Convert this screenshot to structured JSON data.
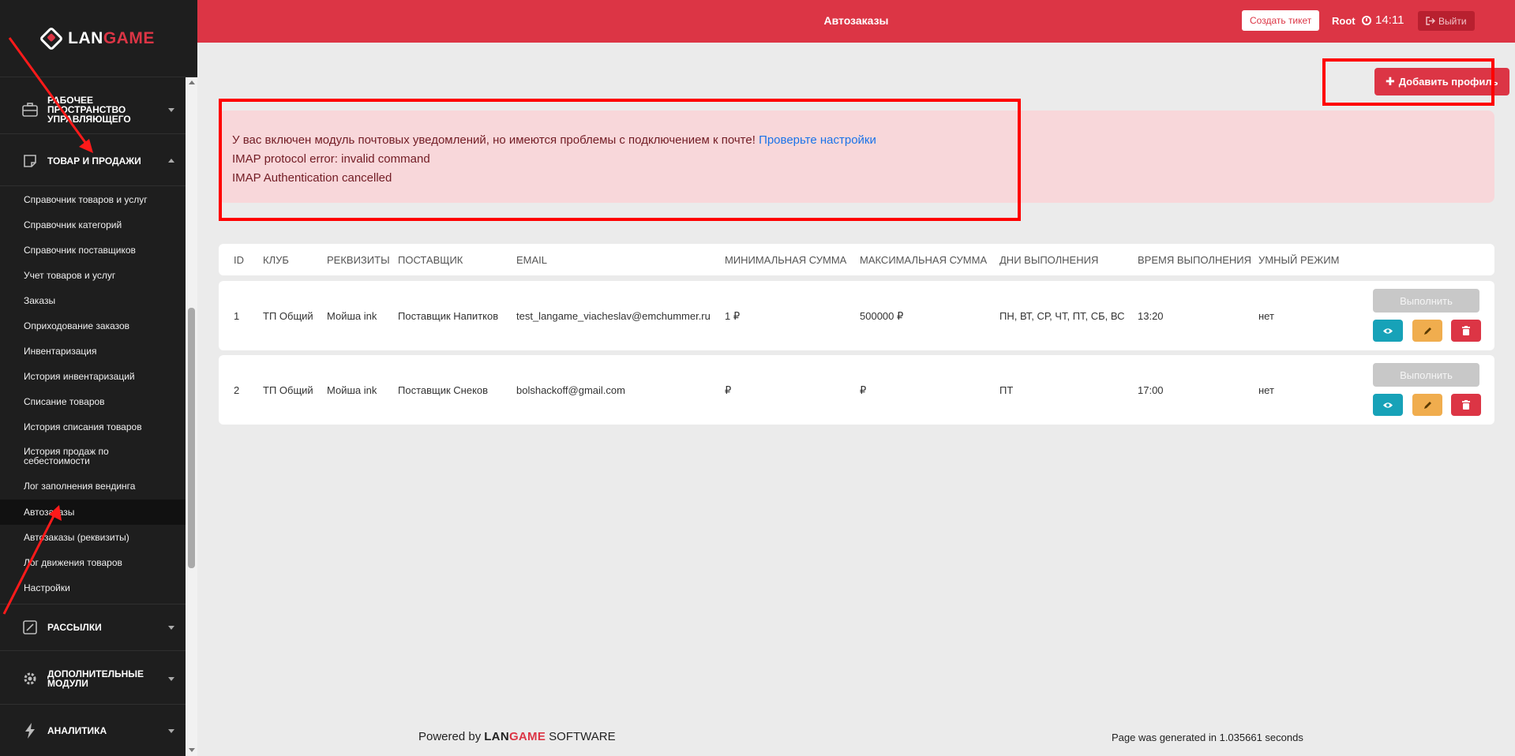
{
  "app": {
    "logo": {
      "text_main": "LAN",
      "text_accent": "GAME"
    }
  },
  "header": {
    "title": "Автозаказы",
    "ticket_button": "Создать тикет",
    "user": "Root",
    "time": "14:11",
    "logout": "Выйти"
  },
  "sidebar": {
    "sections": [
      {
        "label": "Рабочее пространство управляющего",
        "icon": "briefcase-icon",
        "expanded": false
      },
      {
        "label": "Товар и продажи",
        "icon": "sticky-note-icon",
        "expanded": true
      },
      {
        "label": "Рассылки",
        "icon": "edit-icon",
        "expanded": false
      },
      {
        "label": "Дополнительные модули",
        "icon": "gear-icon",
        "expanded": false
      },
      {
        "label": "Аналитика",
        "icon": "lightning-icon",
        "expanded": false
      }
    ],
    "items": [
      "Справочник товаров и услуг",
      "Справочник категорий",
      "Справочник поставщиков",
      "Учет товаров и услуг",
      "Заказы",
      "Оприходование заказов",
      "Инвентаризация",
      "История инвентаризаций",
      "Списание товаров",
      "История списания товаров",
      "История продаж по себестоимости",
      "Лог заполнения вендинга",
      "Автозаказы",
      "Автозаказы (реквизиты)",
      "Лог движения товаров",
      "Настройки"
    ],
    "active_item": "Автозаказы"
  },
  "main": {
    "add_profile_button": "Добавить профиль",
    "alert": {
      "text": "У вас включен модуль почтовых уведомлений, но имеются проблемы с подключением к почте! ",
      "link": "Проверьте настройки",
      "line2": "IMAP protocol error: invalid command",
      "line3": "IMAP Authentication cancelled"
    },
    "table": {
      "headers": [
        "ID",
        "Клуб",
        "Реквизиты",
        "Поставщик",
        "Email",
        "Минимальная сумма",
        "Максимальная сумма",
        "Дни выполнения",
        "Время выполнения",
        "Умный режим"
      ],
      "rows": [
        [
          "1",
          "ТП Общий",
          "Мойша ink",
          "Поставщик Напитков",
          "test_langame_viacheslav@emchummer.ru",
          "1 ₽",
          "500000 ₽",
          "ПН, ВТ, СР, ЧТ, ПТ, СБ, ВС",
          "13:20",
          "нет"
        ],
        [
          "2",
          "ТП Общий",
          "Мойша ink",
          "Поставщик Снеков",
          "bolshackoff@gmail.com",
          "₽",
          "₽",
          "ПТ",
          "17:00",
          "нет"
        ]
      ],
      "execute_label": "Выполнить"
    }
  },
  "footer": {
    "powered_prefix": "Powered by",
    "brand_main": "LAN",
    "brand_accent": "GAME",
    "powered_suffix": "SOFTWARE",
    "generated": "Page was generated in 1.035661 seconds"
  },
  "colors": {
    "brand_red": "#dc3545",
    "sidebar_bg": "#1e1e1e",
    "alert_bg": "#f8d7da",
    "view_btn": "#17a2b8",
    "edit_btn": "#f0ad4e"
  }
}
